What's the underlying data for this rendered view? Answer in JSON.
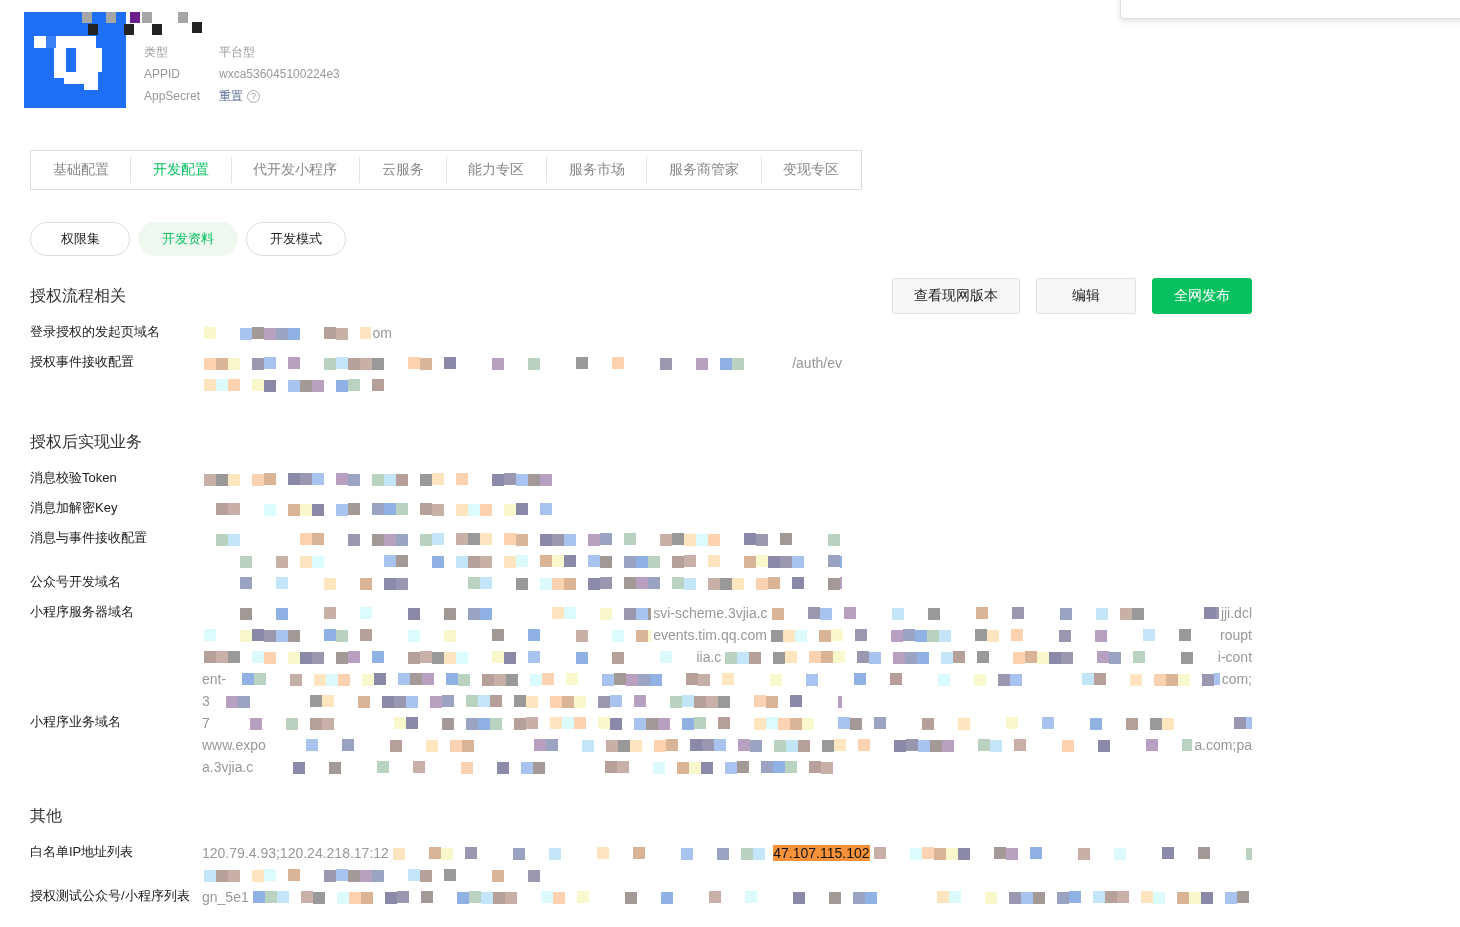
{
  "app": {
    "type_label": "类型",
    "type_value": "平台型",
    "appid_label": "APPID",
    "appid_value": "wxca536045100224e3",
    "secret_label": "AppSecret",
    "secret_action": "重置",
    "secret_help": "?"
  },
  "tabs": [
    {
      "label": "基础配置",
      "selected": false
    },
    {
      "label": "开发配置",
      "selected": true
    },
    {
      "label": "代开发小程序",
      "selected": false
    },
    {
      "label": "云服务",
      "selected": false
    },
    {
      "label": "能力专区",
      "selected": false
    },
    {
      "label": "服务市场",
      "selected": false
    },
    {
      "label": "服务商管家",
      "selected": false
    },
    {
      "label": "变现专区",
      "selected": false
    }
  ],
  "subtabs": [
    {
      "label": "权限集",
      "selected": false
    },
    {
      "label": "开发资料",
      "selected": true
    },
    {
      "label": "开发模式",
      "selected": false
    }
  ],
  "actions": [
    {
      "label": "查看现网版本",
      "kind": "default"
    },
    {
      "label": "编辑",
      "kind": "default"
    },
    {
      "label": "全网发布",
      "kind": "primary"
    }
  ],
  "sections": [
    {
      "title": "授权流程相关",
      "fields": [
        {
          "label": "登录授权的发起页域名",
          "lines": [
            {
              "kind": "short",
              "segments": [
                {
                  "kind": "pixels"
                },
                {
                  "kind": "text",
                  "text": "om"
                }
              ]
            }
          ]
        },
        {
          "label": "授权事件接收配置",
          "lines": [
            {
              "kind": "long",
              "segments": [
                {
                  "kind": "pixels"
                },
                {
                  "kind": "text",
                  "text": "/auth/ev"
                }
              ]
            },
            {
              "kind": "short",
              "segments": [
                {
                  "kind": "pixels"
                }
              ]
            }
          ]
        }
      ]
    },
    {
      "title": "授权后实现业务",
      "fields": [
        {
          "label": "消息校验Token",
          "lines": [
            {
              "kind": "medium",
              "segments": [
                {
                  "kind": "pixels"
                }
              ]
            }
          ]
        },
        {
          "label": "消息加解密Key",
          "lines": [
            {
              "kind": "medium",
              "segments": [
                {
                  "kind": "pixels"
                }
              ]
            }
          ]
        },
        {
          "label": "消息与事件接收配置",
          "lines": [
            {
              "kind": "long",
              "segments": [
                {
                  "kind": "pixels"
                }
              ]
            },
            {
              "kind": "long",
              "segments": [
                {
                  "kind": "pixels"
                }
              ]
            }
          ]
        },
        {
          "label": "公众号开发域名",
          "lines": [
            {
              "kind": "long",
              "segments": [
                {
                  "kind": "pixels"
                }
              ]
            }
          ]
        },
        {
          "label": "小程序服务器域名",
          "lines": [
            {
              "kind": "full",
              "segments": [
                {
                  "kind": "pixels"
                },
                {
                  "kind": "text",
                  "text": "svi-scheme.3vjia.c"
                },
                {
                  "kind": "pixels"
                },
                {
                  "kind": "text",
                  "text": "jji.dcl"
                }
              ]
            },
            {
              "kind": "full",
              "segments": [
                {
                  "kind": "pixels"
                },
                {
                  "kind": "text",
                  "text": "events.tim.qq.com"
                },
                {
                  "kind": "pixels"
                },
                {
                  "kind": "text",
                  "text": "roupt"
                }
              ]
            },
            {
              "kind": "full",
              "segments": [
                {
                  "kind": "pixels"
                },
                {
                  "kind": "text",
                  "text": "iia.c"
                },
                {
                  "kind": "pixels"
                },
                {
                  "kind": "text",
                  "text": "i-cont"
                }
              ]
            },
            {
              "kind": "full",
              "segments": [
                {
                  "kind": "text",
                  "text": "ent-"
                },
                {
                  "kind": "pixels"
                },
                {
                  "kind": "text",
                  "text": "com;"
                }
              ]
            },
            {
              "kind": "long",
              "segments": [
                {
                  "kind": "text",
                  "text": "3"
                },
                {
                  "kind": "pixels"
                }
              ]
            }
          ]
        },
        {
          "label": "小程序业务域名",
          "lines": [
            {
              "kind": "full",
              "segments": [
                {
                  "kind": "text",
                  "text": "7"
                },
                {
                  "kind": "pixels"
                }
              ]
            },
            {
              "kind": "full",
              "segments": [
                {
                  "kind": "text",
                  "text": "www.expo"
                },
                {
                  "kind": "pixels"
                },
                {
                  "kind": "text",
                  "text": "a.com;pa"
                }
              ]
            },
            {
              "kind": "long",
              "segments": [
                {
                  "kind": "text",
                  "text": "a.3vjia.c"
                },
                {
                  "kind": "pixels"
                }
              ]
            }
          ]
        }
      ]
    },
    {
      "title": "其他",
      "fields": [
        {
          "label": "白名单IP地址列表",
          "lines": [
            {
              "kind": "full",
              "segments": [
                {
                  "kind": "text",
                  "text": "120.79.4.93;120.24.218.17:12"
                },
                {
                  "kind": "pixels"
                },
                {
                  "kind": "mark",
                  "text": "47.107.115.102"
                },
                {
                  "kind": "pixels"
                }
              ]
            },
            {
              "kind": "medium",
              "segments": [
                {
                  "kind": "pixels"
                }
              ]
            }
          ]
        },
        {
          "label": "授权测试公众号/小程序列表",
          "lines": [
            {
              "kind": "full",
              "segments": [
                {
                  "kind": "text",
                  "text": "gn_5e1"
                },
                {
                  "kind": "pixels"
                }
              ]
            }
          ]
        }
      ]
    }
  ]
}
